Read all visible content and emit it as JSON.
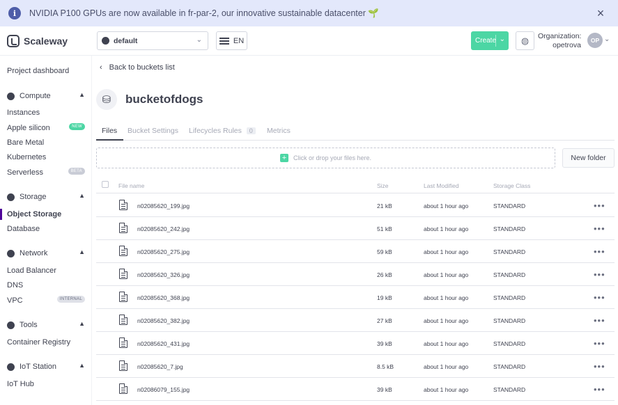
{
  "banner": {
    "message": "NVIDIA P100 GPUs are now available in fr-par-2, our innovative sustainable datacenter 🌱",
    "info_icon": "i",
    "close_icon": "×"
  },
  "topbar": {
    "logo_text": "Scaleway",
    "project": "default",
    "language": "EN",
    "create_label": "Create",
    "org_label": "Organization:",
    "org_name": "opetrova",
    "avatar_initials": "OP"
  },
  "sidebar": {
    "project_dashboard": "Project dashboard",
    "sections": [
      {
        "label": "Compute",
        "items": [
          "Instances",
          "Apple silicon",
          "Bare Metal",
          "Kubernetes",
          "Serverless"
        ]
      },
      {
        "label": "Storage",
        "items": [
          "Object Storage",
          "Database"
        ]
      },
      {
        "label": "Network",
        "items": [
          "Load Balancer",
          "DNS",
          "VPC"
        ]
      },
      {
        "label": "Tools",
        "items": [
          "Container Registry"
        ]
      },
      {
        "label": "IoT Station",
        "items": [
          "IoT Hub"
        ]
      }
    ],
    "badges": {
      "apple_silicon": "New",
      "serverless": "Beta",
      "vpc": "Internal"
    },
    "active_item": "Object Storage"
  },
  "main": {
    "back_label": "Back to buckets list",
    "bucket_name": "bucketofdogs",
    "tabs": [
      {
        "label": "Files"
      },
      {
        "label": "Bucket Settings"
      },
      {
        "label": "Lifecycles Rules",
        "count": "0"
      },
      {
        "label": "Metrics"
      }
    ],
    "dropzone_text": "Click or drop your files here.",
    "new_folder_label": "New folder",
    "columns": [
      "File name",
      "Size",
      "Last Modified",
      "Storage Class"
    ],
    "files": [
      {
        "name": "n02085620_199.jpg",
        "size": "21 kB",
        "modified": "about 1 hour ago",
        "class": "STANDARD"
      },
      {
        "name": "n02085620_242.jpg",
        "size": "51 kB",
        "modified": "about 1 hour ago",
        "class": "STANDARD"
      },
      {
        "name": "n02085620_275.jpg",
        "size": "59 kB",
        "modified": "about 1 hour ago",
        "class": "STANDARD"
      },
      {
        "name": "n02085620_326.jpg",
        "size": "26 kB",
        "modified": "about 1 hour ago",
        "class": "STANDARD"
      },
      {
        "name": "n02085620_368.jpg",
        "size": "19 kB",
        "modified": "about 1 hour ago",
        "class": "STANDARD"
      },
      {
        "name": "n02085620_382.jpg",
        "size": "27 kB",
        "modified": "about 1 hour ago",
        "class": "STANDARD"
      },
      {
        "name": "n02085620_431.jpg",
        "size": "39 kB",
        "modified": "about 1 hour ago",
        "class": "STANDARD"
      },
      {
        "name": "n02085620_7.jpg",
        "size": "8.5 kB",
        "modified": "about 1 hour ago",
        "class": "STANDARD"
      },
      {
        "name": "n02086079_155.jpg",
        "size": "39 kB",
        "modified": "about 1 hour ago",
        "class": "STANDARD"
      }
    ]
  }
}
